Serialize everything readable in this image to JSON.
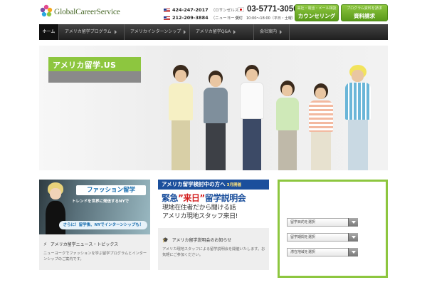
{
  "header": {
    "logo_text": "GlobalCareerService",
    "phones": [
      {
        "number": "424-247-2017",
        "city": "（ロサンゼルス）"
      },
      {
        "number": "212-209-3884",
        "city": "（ニューヨーク）"
      }
    ],
    "jp_phone": "03-5771-3050",
    "jp_hours": "受付　10:00〜18:00（平日・土曜）",
    "buttons": [
      {
        "small": "来社・電話・メール相談",
        "big": "カウンセリング"
      },
      {
        "small": "プログラム資料を請求",
        "big": "資料請求"
      }
    ]
  },
  "nav": [
    {
      "label": "ホーム"
    },
    {
      "label": "アメリカ留学プログラム"
    },
    {
      "label": "アメリカインターンシップ"
    },
    {
      "label": "アメリカ留学Q&A"
    },
    {
      "label": "会社案内"
    }
  ],
  "hero": {
    "badge": "アメリカ留学.US"
  },
  "box1": {
    "title": "ファッション留学",
    "subtitle": "トレンドを世界に発信するNYで",
    "tag": "さらに！留学後、NYでインターンシップも！",
    "heading": "アメリカ留学ニュース・トピックス",
    "text": "ニューヨークでファッションを学ぶ留学プログラムとインターンシップのご案内です。"
  },
  "box2": {
    "banner_top": "アメリカ留学検討中の方へ",
    "banner_month": "3月開催",
    "headline_a": "緊急",
    "headline_b": "”来日”",
    "headline_c": "留学説明会",
    "line1": "現地在住者だから聞ける話",
    "line2": "アメリカ現地スタッフ来日!",
    "heading": "アメリカ留学説明会のお知らせ",
    "text": "アメリカ現地スタッフによる留学説明会を開催いたします。お気軽にご参加ください。"
  },
  "box3": {
    "selects": [
      "留学目的を選択",
      "留学期間を選択",
      "滞在地域を選択"
    ]
  },
  "colors": {
    "accent": "#8dc63f",
    "nav_bg": "#2b2b2b",
    "seminar_blue": "#1b4f9c",
    "seminar_red": "#d21c1c"
  }
}
